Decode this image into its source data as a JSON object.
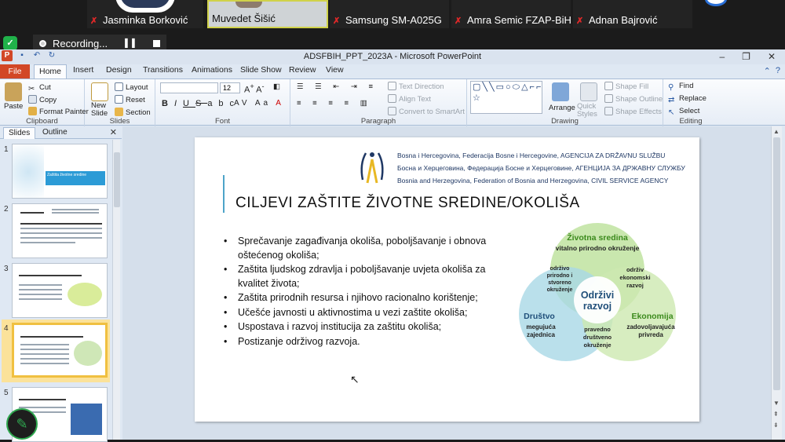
{
  "zoom": {
    "participants": [
      {
        "name": "Jasminka Borković",
        "muted": true
      },
      {
        "name": "Muvedet Šišić",
        "muted": false
      },
      {
        "name": "Samsung SM-A025G",
        "muted": true
      },
      {
        "name": "Amra Semic FZAP-BiH",
        "muted": true
      },
      {
        "name": "Adnan Bajrović",
        "muted": true
      }
    ],
    "recording_label": "Recording...",
    "pause_icon": "pause-icon",
    "stop_icon": "stop-icon"
  },
  "window": {
    "title": "ADSFBIH_PPT_2023A - Microsoft PowerPoint",
    "minimize": "–",
    "maximize": "❐",
    "close": "✕"
  },
  "tabs": [
    "File",
    "Home",
    "Insert",
    "Design",
    "Transitions",
    "Animations",
    "Slide Show",
    "Review",
    "View"
  ],
  "ribbon": {
    "clipboard": {
      "label": "Clipboard",
      "paste": "Paste",
      "cut": "Cut",
      "copy": "Copy",
      "format_painter": "Format Painter"
    },
    "slides": {
      "label": "Slides",
      "new_slide": "New Slide",
      "layout": "Layout",
      "reset": "Reset",
      "section": "Section"
    },
    "font": {
      "label": "Font",
      "size": "12"
    },
    "paragraph": {
      "label": "Paragraph",
      "text_direction": "Text Direction",
      "align_text": "Align Text",
      "convert": "Convert to SmartArt"
    },
    "drawing": {
      "label": "Drawing",
      "arrange": "Arrange",
      "quick_styles": "Quick Styles",
      "shape_fill": "Shape Fill",
      "shape_outline": "Shape Outline",
      "shape_effects": "Shape Effects",
      "shape_glyphs": "▢╲╲▭○⬭△⌐⌐⇨⇩⇦↘↖⌒❴❵☆"
    },
    "editing": {
      "label": "Editing",
      "find": "Find",
      "replace": "Replace",
      "select": "Select"
    }
  },
  "pane": {
    "tab_slides": "Slides",
    "tab_outline": "Outline",
    "close": "✕",
    "slide_numbers": [
      "1",
      "2",
      "3",
      "4",
      "5"
    ],
    "thumb1_text": "Zaštita životne sredine"
  },
  "slide": {
    "agency_lines": [
      "Bosna i Hercegovina, Federacija Bosne i Hercegovine, AGENCIJA ZA DRŽAVNU SLUŽBU",
      "Босна и Херцеговина, Федерација Босне и Херцеговине, АГЕНЦИЈА ЗА ДРЖАВНУ СЛУЖБУ",
      "Bosnia and Herzegovina, Federation of Bosnia and Herzegovina, CIVIL SERVICE AGENCY"
    ],
    "title": "CILJEVI ZAŠTITE ŽIVOTNE SREDINE/OKOLIŠA",
    "bullets": [
      "Sprečavanje zagađivanja okoliša, poboljšavanje  i obnova oštećenog okoliša;",
      "Zaštita ljudskog zdravlja i poboljšavanje  uvjeta  okoliša za kvalitet života;",
      "Zaštita prirodnih resursa i njihovo racionalno  korištenje;",
      "Učešće javnosti u aktivnostima  u vezi zaštite okoliša;",
      "Uspostava i razvoj institucija za zaštitu okoliša;",
      "Postizanje održivog razvoja."
    ],
    "venn": {
      "top_title": "Životna sredina",
      "top_sub": "vitalno prirodno okruženje",
      "left_title": "Društvo",
      "left_sub_1": "megujuća",
      "left_sub_2": "zajednica",
      "right_title": "Ekonomija",
      "right_sub_1": "zadovoljavajuća",
      "right_sub_2": "privreda",
      "tl_1": "održivo",
      "tl_2": "prirodno i",
      "tl_3": "stvoreno",
      "tl_4": "okruženje",
      "tr_1": "održiv",
      "tr_2": "ekonomski",
      "tr_3": "razvoj",
      "bottom_1": "pravedno",
      "bottom_2": "društveno",
      "bottom_3": "okruženje",
      "center_1": "Održivi",
      "center_2": "razvoj",
      "colors": {
        "top": "#bfe3a0",
        "left": "#a9d8e6",
        "right": "#cde8b0",
        "center": "#ffffff",
        "title": "#1f4e79",
        "top_title": "#3b8a1c",
        "econ": "#3b8a1c"
      }
    }
  }
}
